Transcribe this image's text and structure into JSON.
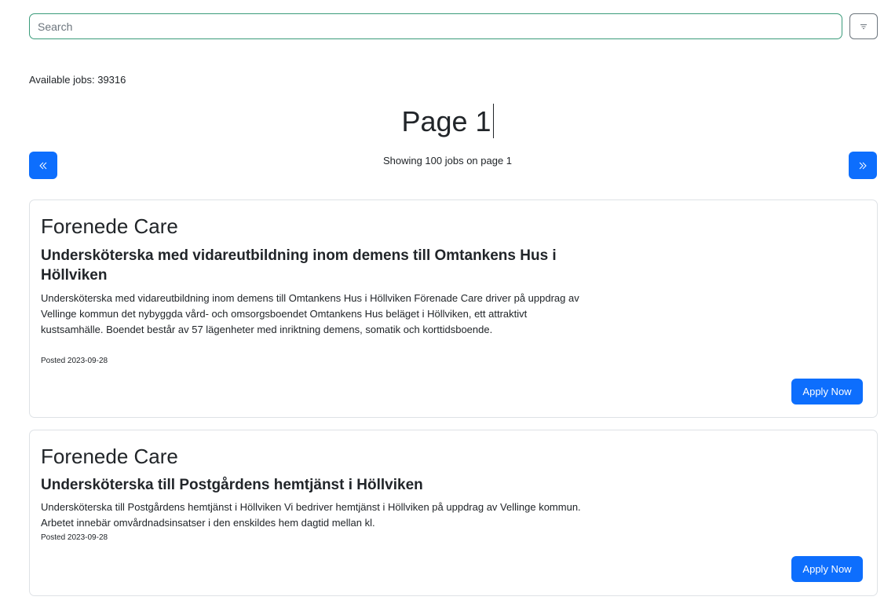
{
  "search": {
    "placeholder": "Search",
    "value": ""
  },
  "filter": {
    "icon": "filter-icon"
  },
  "available": {
    "label": "Available jobs:",
    "count": "39316"
  },
  "pagination": {
    "title": "Page 1",
    "showing": "Showing 100 jobs on page 1",
    "prev_icon": "double-chevron-left-icon",
    "next_icon": "double-chevron-right-icon"
  },
  "jobs": [
    {
      "company": "Forenede Care",
      "title": "Undersköterska med vidareutbildning inom demens till Omtankens Hus i Höllviken",
      "description": "Undersköterska med vidareutbildning inom demens till Omtankens Hus i Höllviken Förenade Care driver på uppdrag av Vellinge kommun det nybyggda vård- och omsorgsboendet Omtankens Hus beläget i Höllviken, ett attraktivt kustsamhälle. Boendet består av 57 lägenheter med inriktning demens, somatik och korttidsboende.",
      "posted": "Posted 2023-09-28",
      "apply_label": "Apply Now"
    },
    {
      "company": "Forenede Care",
      "title": "Undersköterska till Postgårdens hemtjänst i Höllviken",
      "description": "Undersköterska till Postgårdens hemtjänst i Höllviken Vi bedriver hemtjänst i Höllviken på uppdrag av Vellinge kommun. Arbetet innebär omvårdnadsinsatser i den enskildes hem dagtid mellan kl.",
      "posted": "Posted 2023-09-28",
      "apply_label": "Apply Now"
    }
  ],
  "colors": {
    "primary": "#0d6efd",
    "search_border": "#3a9b7a",
    "card_border": "#dee2e6"
  }
}
